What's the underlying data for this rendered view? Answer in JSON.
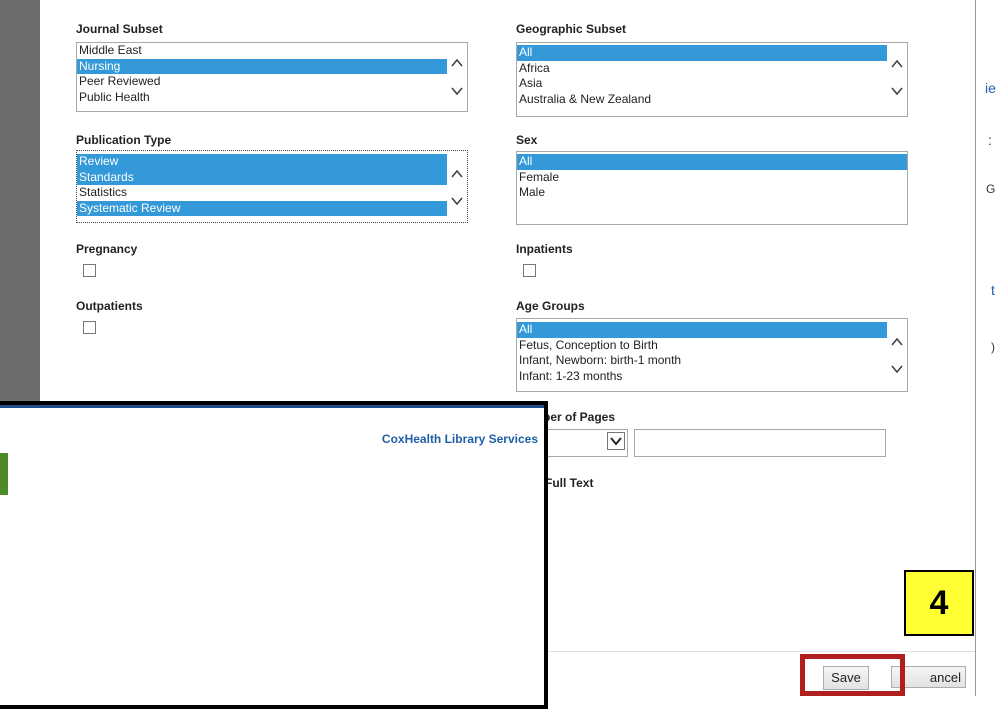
{
  "journal_subset": {
    "label": "Journal Subset",
    "options": [
      {
        "text": "Middle East",
        "selected": false
      },
      {
        "text": "Nursing",
        "selected": true
      },
      {
        "text": "Peer Reviewed",
        "selected": false
      },
      {
        "text": "Public Health",
        "selected": false
      }
    ]
  },
  "geographic_subset": {
    "label": "Geographic Subset",
    "options": [
      {
        "text": "All",
        "selected": true
      },
      {
        "text": "Africa",
        "selected": false
      },
      {
        "text": "Asia",
        "selected": false
      },
      {
        "text": "Australia & New Zealand",
        "selected": false
      }
    ]
  },
  "publication_type": {
    "label": "Publication Type",
    "options": [
      {
        "text": "Review",
        "selected": true
      },
      {
        "text": "Standards",
        "selected": true
      },
      {
        "text": "Statistics",
        "selected": false
      },
      {
        "text": "Systematic Review",
        "selected": true
      }
    ]
  },
  "sex": {
    "label": "Sex",
    "options": [
      {
        "text": "All",
        "selected": true
      },
      {
        "text": "Female",
        "selected": false
      },
      {
        "text": "Male",
        "selected": false
      }
    ]
  },
  "pregnancy": {
    "label": "Pregnancy",
    "checked": false
  },
  "inpatients": {
    "label": "Inpatients",
    "checked": false
  },
  "outpatients": {
    "label": "Outpatients",
    "checked": false
  },
  "age_groups": {
    "label": "Age Groups",
    "options": [
      {
        "text": "All",
        "selected": true
      },
      {
        "text": "Fetus, Conception to Birth",
        "selected": false
      },
      {
        "text": "Infant, Newborn: birth-1 month",
        "selected": false
      },
      {
        "text": "Infant: 1-23 months",
        "selected": false
      }
    ]
  },
  "number_of_pages": {
    "label": "ber of Pages",
    "value": ""
  },
  "full_text": {
    "label": "Full Text"
  },
  "buttons": {
    "save": "Save",
    "cancel": "ancel"
  },
  "overlay": {
    "link": "CoxHealth Library Services"
  },
  "callout": {
    "text": "4"
  },
  "right_peek": {
    "t1": "ie",
    "t2": ":",
    "t3": "G",
    "t4": "t",
    "t5": ")"
  },
  "colors": {
    "selection": "#3399d9",
    "callout_bg": "#ffff33",
    "highlight_border": "#b11e1e",
    "link": "#1f5fa8"
  }
}
